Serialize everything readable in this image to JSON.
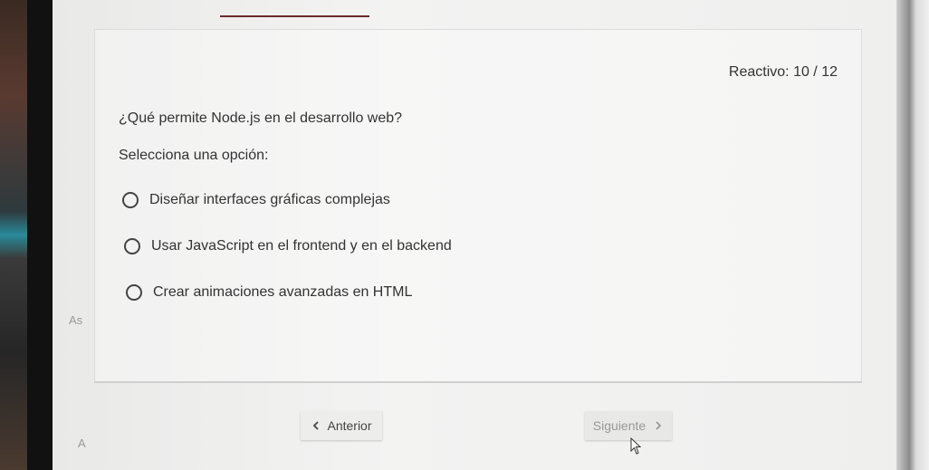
{
  "quiz": {
    "counter_label": "Reactivo:",
    "counter_value": "10 / 12",
    "question": "¿Qué permite Node.js en el desarrollo web?",
    "instruction": "Selecciona una opción:",
    "options": [
      {
        "label": "Diseñar interfaces gráficas complejas",
        "selected": false
      },
      {
        "label": "Usar JavaScript en el frontend y en el backend",
        "selected": false
      },
      {
        "label": "Crear animaciones avanzadas en HTML",
        "selected": false
      }
    ]
  },
  "nav": {
    "prev_label": "Anterior",
    "next_label": "Siguiente",
    "prev_icon": "chevron-left-icon",
    "next_icon": "chevron-right-icon"
  },
  "side": {
    "letter_1": "As",
    "letter_2": "A"
  },
  "colors": {
    "accent_rule": "#6b2a2a",
    "text": "#333333",
    "disabled_text": "#999999"
  }
}
